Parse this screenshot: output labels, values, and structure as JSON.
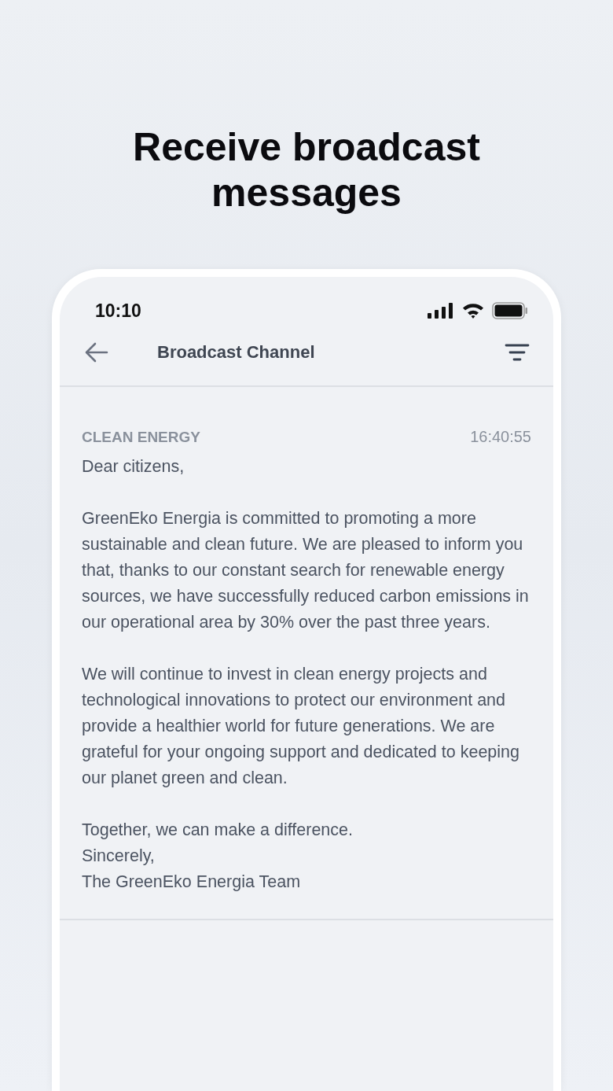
{
  "headline": "Receive broadcast messages",
  "status_bar": {
    "time": "10:10"
  },
  "header": {
    "title": "Broadcast Channel"
  },
  "messages": [
    {
      "channel": "CLEAN ENERGY",
      "time": "16:40:55",
      "blocks": [
        {
          "lines": [
            "Dear citizens,"
          ]
        },
        {
          "lines": [
            "GreenEko Energia is committed to promoting a more sustainable and clean future. We are pleased to inform you that, thanks to our constant search for renewable energy sources, we have successfully reduced carbon emissions in our operational area by 30% over the past three years."
          ]
        },
        {
          "lines": [
            "We will continue to invest in clean energy projects and technological innovations to protect our environment and provide a healthier world for future generations. We are grateful for your ongoing support and dedicated to keeping our planet green and clean."
          ]
        },
        {
          "lines": [
            "Together, we can make a difference.",
            "Sincerely,",
            "The GreenEko Energia Team"
          ]
        }
      ]
    }
  ]
}
